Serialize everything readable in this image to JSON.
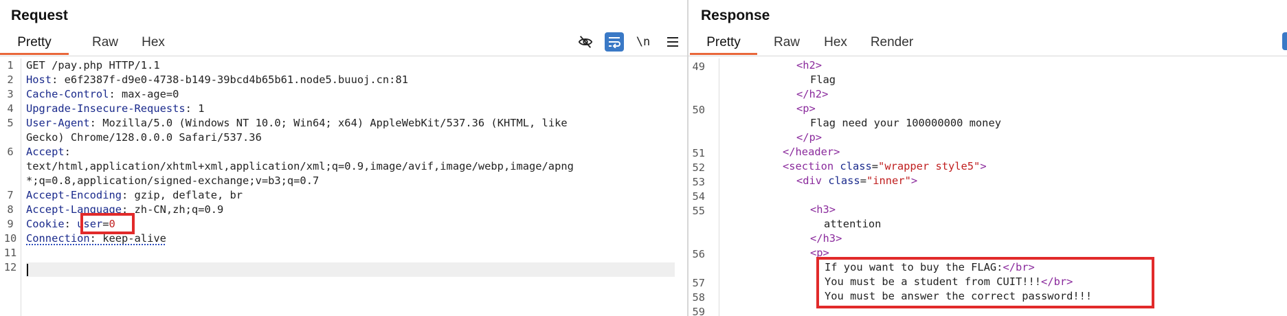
{
  "request": {
    "title": "Request",
    "tabs": [
      "Pretty",
      "Raw",
      "Hex"
    ],
    "active_tab": "Pretty",
    "toolbar": {
      "hide_icon": "eye-off-icon",
      "wrap_icon": "wrap-lines-icon",
      "newline_label": "\\n",
      "menu_icon": "hamburger-menu-icon"
    },
    "line_numbers": [
      "1",
      "2",
      "3",
      "4",
      "5",
      "6",
      "7",
      "8",
      "9",
      "10",
      "11",
      "12"
    ],
    "lines": {
      "l1": "GET /pay.php HTTP/1.1",
      "l2k": "Host",
      "l2v": ": e6f2387f-d9e0-4738-b149-39bcd4b65b61.node5.buuoj.cn:81",
      "l3k": "Cache-Control",
      "l3v": ": max-age=0",
      "l4k": "Upgrade-Insecure-Requests",
      "l4v": ": 1",
      "l5k": "User-Agent",
      "l5v": ": Mozilla/5.0 (Windows NT 10.0; Win64; x64) AppleWebKit/537.36 (KHTML, like",
      "l5b": "Gecko) Chrome/128.0.0.0 Safari/537.36",
      "l6k": "Accept",
      "l6v": ":",
      "l6b": "text/html,application/xhtml+xml,application/xml;q=0.9,image/avif,image/webp,image/apng",
      "l6c": "*;q=0.8,application/signed-exchange;v=b3;q=0.7",
      "l7k": "Accept-Encoding",
      "l7v": ": gzip, deflate, br",
      "l8k": "Accept-Language",
      "l8v": ": zh-CN,zh;q=0.9",
      "l9k": "Cookie",
      "l9v": ": ",
      "l9ck": "user",
      "l9eq": "=",
      "l9cv": "0",
      "l10k": "Connection",
      "l10v": ": keep-alive"
    }
  },
  "response": {
    "title": "Response",
    "tabs": [
      "Pretty",
      "Raw",
      "Hex",
      "Render"
    ],
    "active_tab": "Pretty",
    "line_numbers": [
      "49",
      "50",
      "51",
      "52",
      "53",
      "54",
      "55",
      "56",
      "57",
      "58",
      "59"
    ],
    "lines": {
      "h2open": "<h2>",
      "flag": "Flag",
      "h2close": "</h2>",
      "popen": "<p>",
      "flagneed": "Flag need your 100000000 money",
      "pclose": "</p>",
      "headerclose": "</header>",
      "section_open": "<section",
      "section_attr": "class",
      "section_eq": "=",
      "section_val": "\"wrapper style5\"",
      "section_end": ">",
      "div_open": "<div",
      "div_attr": "class",
      "div_eq": "=",
      "div_val": "\"inner\"",
      "div_end": ">",
      "h3open": "<h3>",
      "attention": "attention",
      "h3close": "</h3>",
      "p2open": "<p>",
      "buy": "If you want to buy the FLAG:",
      "br1": "</br>",
      "student": "You must be a student from CUIT!!!",
      "br2": "</br>",
      "password": "You must be answer the correct password!!!"
    }
  },
  "colors": {
    "accent_tab": "#e8673a",
    "highlight_box": "#e12a2a",
    "toolbar_active": "#3a79c6",
    "header_key": "#1a2a8c",
    "tag": "#8a2a9c",
    "string": "#c01e1e"
  }
}
